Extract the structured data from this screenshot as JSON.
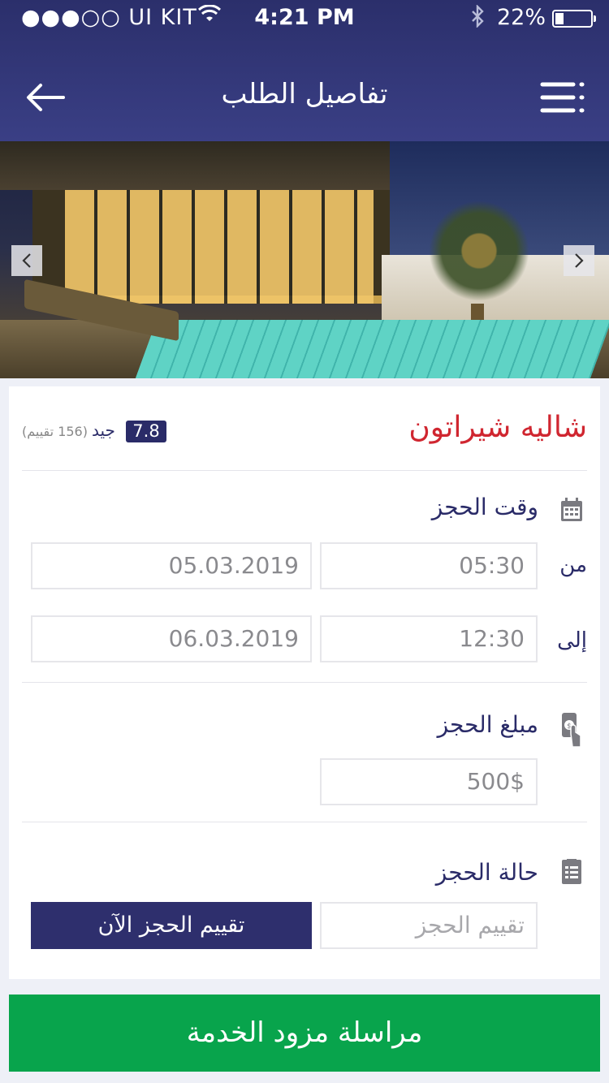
{
  "status_bar": {
    "carrier": "●●●○○ UI KIT",
    "time": "4:21 PM",
    "battery": "22%"
  },
  "header": {
    "title": "تفاصيل الطلب"
  },
  "listing": {
    "name": "شاليه شيراتون",
    "rating": "7.8",
    "rating_word": "جيد",
    "review_count": "(156 تقييم)"
  },
  "booking_time": {
    "title": "وقت الحجز",
    "from_label": "من",
    "from_time": "05:30",
    "from_date": "05.03.2019",
    "to_label": "إلى",
    "to_time": "12:30",
    "to_date": "06.03.2019"
  },
  "booking_amount": {
    "title": "مبلغ الحجز",
    "value": "500$"
  },
  "booking_status": {
    "title": "حالة الحجز",
    "rating_placeholder": "تقييم الحجز",
    "rate_now_label": "تقييم الحجز الآن"
  },
  "contact_button": {
    "label": "مراسلة مزود الخدمة"
  },
  "colors": {
    "header": "#2b2f6b",
    "accent_red": "#d02630",
    "navy": "#2a2b68",
    "cta_green": "#08a44c"
  }
}
